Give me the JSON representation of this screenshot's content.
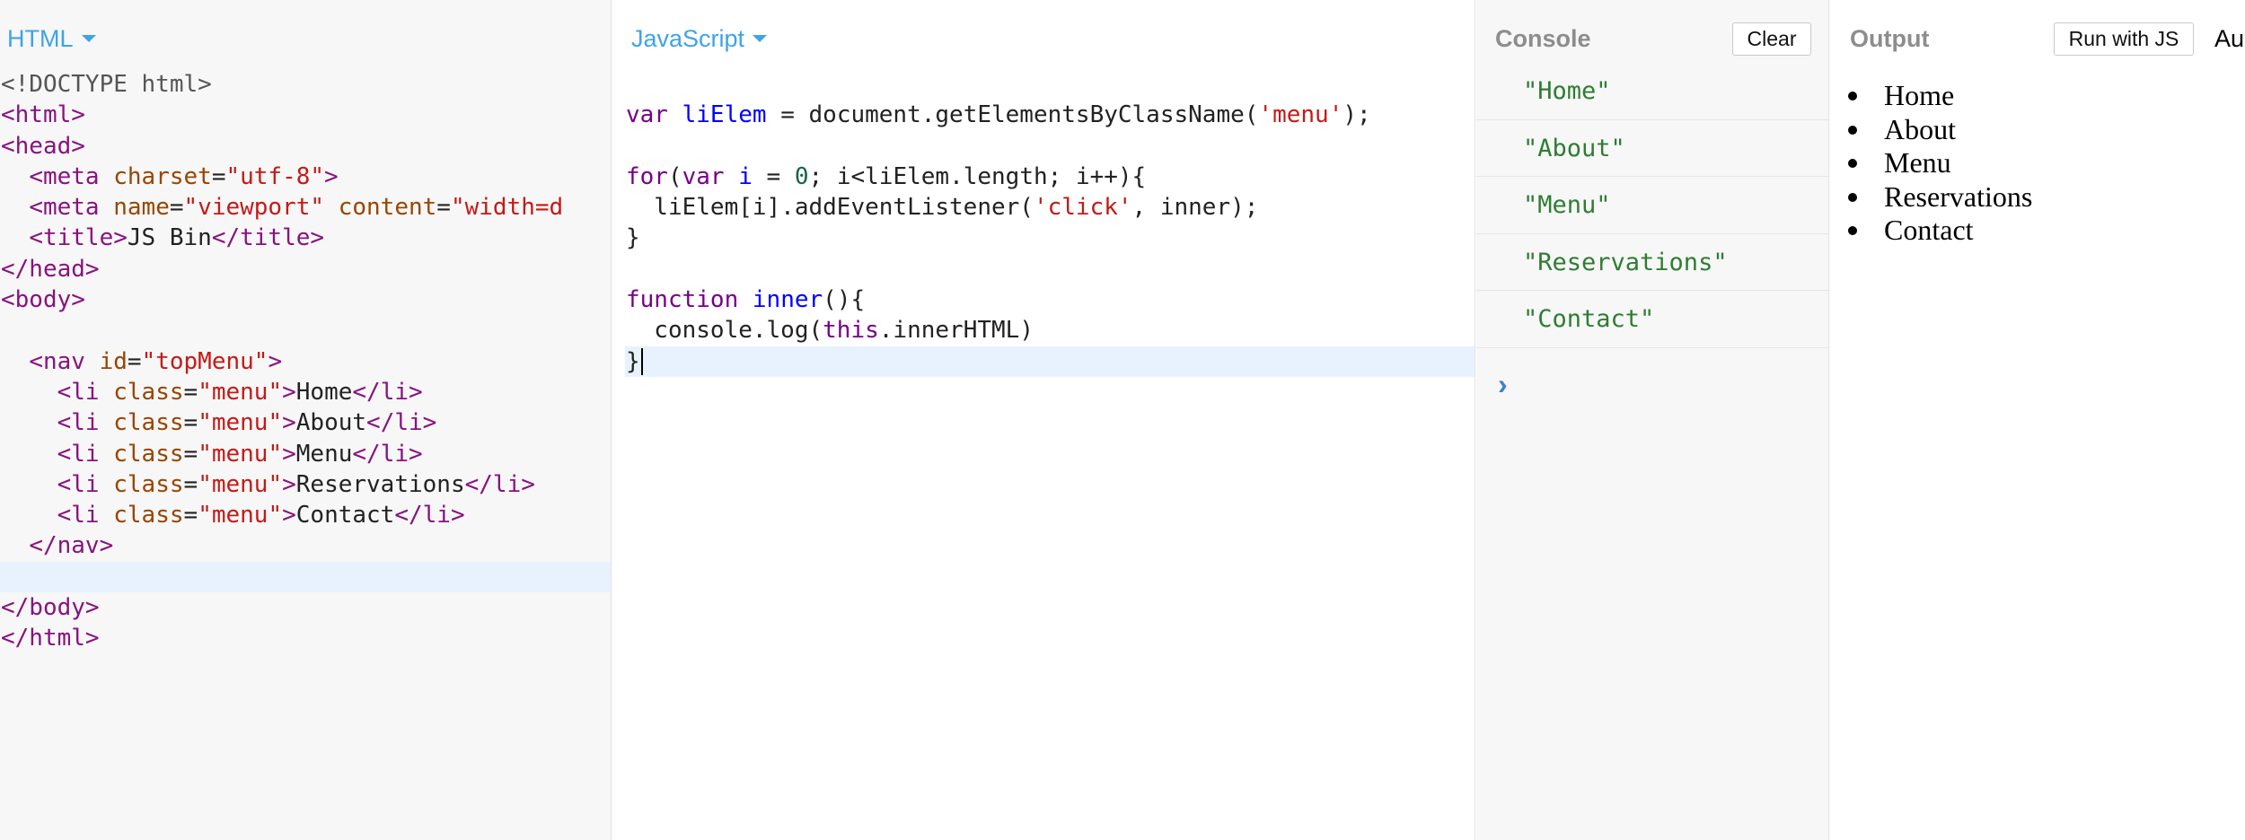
{
  "html_panel": {
    "label": "HTML",
    "lines": [
      [
        {
          "c": "doctype",
          "t": "<!DOCTYPE html>"
        }
      ],
      [
        {
          "c": "tag",
          "t": "<html>"
        }
      ],
      [
        {
          "c": "tag",
          "t": "<head>"
        }
      ],
      [
        {
          "c": "txt",
          "t": "  "
        },
        {
          "c": "tag",
          "t": "<meta "
        },
        {
          "c": "attr",
          "t": "charset"
        },
        {
          "c": "txt",
          "t": "="
        },
        {
          "c": "str",
          "t": "\"utf-8\""
        },
        {
          "c": "tag",
          "t": ">"
        }
      ],
      [
        {
          "c": "txt",
          "t": "  "
        },
        {
          "c": "tag",
          "t": "<meta "
        },
        {
          "c": "attr",
          "t": "name"
        },
        {
          "c": "txt",
          "t": "="
        },
        {
          "c": "str",
          "t": "\"viewport\""
        },
        {
          "c": "txt",
          "t": " "
        },
        {
          "c": "attr",
          "t": "content"
        },
        {
          "c": "txt",
          "t": "="
        },
        {
          "c": "str",
          "t": "\"width=d"
        }
      ],
      [
        {
          "c": "txt",
          "t": "  "
        },
        {
          "c": "tag",
          "t": "<title>"
        },
        {
          "c": "txt",
          "t": "JS Bin"
        },
        {
          "c": "tag",
          "t": "</title>"
        }
      ],
      [
        {
          "c": "tag",
          "t": "</head>"
        }
      ],
      [
        {
          "c": "tag",
          "t": "<body>"
        }
      ],
      [],
      [
        {
          "c": "txt",
          "t": "  "
        },
        {
          "c": "tag",
          "t": "<nav "
        },
        {
          "c": "attr",
          "t": "id"
        },
        {
          "c": "txt",
          "t": "="
        },
        {
          "c": "str",
          "t": "\"topMenu\""
        },
        {
          "c": "tag",
          "t": ">"
        }
      ],
      [
        {
          "c": "txt",
          "t": "    "
        },
        {
          "c": "tag",
          "t": "<li "
        },
        {
          "c": "attr",
          "t": "class"
        },
        {
          "c": "txt",
          "t": "="
        },
        {
          "c": "str",
          "t": "\"menu\""
        },
        {
          "c": "tag",
          "t": ">"
        },
        {
          "c": "txt",
          "t": "Home"
        },
        {
          "c": "tag",
          "t": "</li>"
        }
      ],
      [
        {
          "c": "txt",
          "t": "    "
        },
        {
          "c": "tag",
          "t": "<li "
        },
        {
          "c": "attr",
          "t": "class"
        },
        {
          "c": "txt",
          "t": "="
        },
        {
          "c": "str",
          "t": "\"menu\""
        },
        {
          "c": "tag",
          "t": ">"
        },
        {
          "c": "txt",
          "t": "About"
        },
        {
          "c": "tag",
          "t": "</li>"
        }
      ],
      [
        {
          "c": "txt",
          "t": "    "
        },
        {
          "c": "tag",
          "t": "<li "
        },
        {
          "c": "attr",
          "t": "class"
        },
        {
          "c": "txt",
          "t": "="
        },
        {
          "c": "str",
          "t": "\"menu\""
        },
        {
          "c": "tag",
          "t": ">"
        },
        {
          "c": "txt",
          "t": "Menu"
        },
        {
          "c": "tag",
          "t": "</li>"
        }
      ],
      [
        {
          "c": "txt",
          "t": "    "
        },
        {
          "c": "tag",
          "t": "<li "
        },
        {
          "c": "attr",
          "t": "class"
        },
        {
          "c": "txt",
          "t": "="
        },
        {
          "c": "str",
          "t": "\"menu\""
        },
        {
          "c": "tag",
          "t": ">"
        },
        {
          "c": "txt",
          "t": "Reservations"
        },
        {
          "c": "tag",
          "t": "</li>"
        }
      ],
      [
        {
          "c": "txt",
          "t": "    "
        },
        {
          "c": "tag",
          "t": "<li "
        },
        {
          "c": "attr",
          "t": "class"
        },
        {
          "c": "txt",
          "t": "="
        },
        {
          "c": "str",
          "t": "\"menu\""
        },
        {
          "c": "tag",
          "t": ">"
        },
        {
          "c": "txt",
          "t": "Contact"
        },
        {
          "c": "tag",
          "t": "</li>"
        }
      ],
      [
        {
          "c": "txt",
          "t": "  "
        },
        {
          "c": "tag",
          "t": "</nav>"
        }
      ],
      [],
      [
        {
          "c": "tag",
          "t": "</body>"
        }
      ],
      [
        {
          "c": "tag",
          "t": "</html>"
        }
      ]
    ],
    "active_line": 16
  },
  "js_panel": {
    "label": "JavaScript",
    "lines": [
      [],
      [
        {
          "c": "kw",
          "t": "var "
        },
        {
          "c": "def",
          "t": "liElem"
        },
        {
          "c": "txt",
          "t": " = document.getElementsByClassName("
        },
        {
          "c": "str",
          "t": "'menu'"
        },
        {
          "c": "txt",
          "t": ");"
        }
      ],
      [],
      [
        {
          "c": "kw",
          "t": "for"
        },
        {
          "c": "txt",
          "t": "("
        },
        {
          "c": "kw",
          "t": "var "
        },
        {
          "c": "def",
          "t": "i"
        },
        {
          "c": "txt",
          "t": " = "
        },
        {
          "c": "num",
          "t": "0"
        },
        {
          "c": "txt",
          "t": "; i<liElem.length; i++){"
        }
      ],
      [
        {
          "c": "txt",
          "t": "  liElem[i].addEventListener("
        },
        {
          "c": "str",
          "t": "'click'"
        },
        {
          "c": "txt",
          "t": ", inner);"
        }
      ],
      [
        {
          "c": "txt",
          "t": "}"
        }
      ],
      [],
      [
        {
          "c": "kw",
          "t": "function "
        },
        {
          "c": "def",
          "t": "inner"
        },
        {
          "c": "txt",
          "t": "(){"
        }
      ],
      [
        {
          "c": "txt",
          "t": "  console.log("
        },
        {
          "c": "kw",
          "t": "this"
        },
        {
          "c": "txt",
          "t": ".innerHTML)"
        }
      ],
      [
        {
          "c": "txt",
          "t": "}"
        }
      ]
    ],
    "active_line": 9
  },
  "console_panel": {
    "label": "Console",
    "clear_label": "Clear",
    "entries": [
      "\"Home\"",
      "\"About\"",
      "\"Menu\"",
      "\"Reservations\"",
      "\"Contact\""
    ],
    "prompt": "›"
  },
  "output_panel": {
    "label": "Output",
    "run_label": "Run with JS",
    "trailing_text": "Au",
    "items": [
      "Home",
      "About",
      "Menu",
      "Reservations",
      "Contact"
    ]
  }
}
